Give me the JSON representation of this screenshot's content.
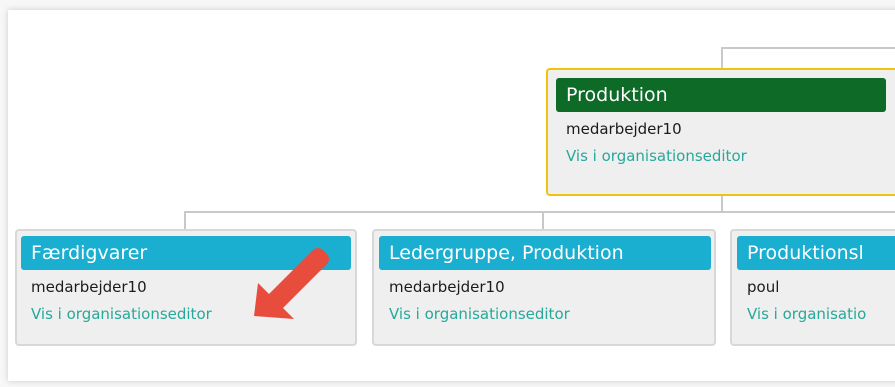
{
  "org_chart": {
    "parent": {
      "title": "Produktion",
      "person": "medarbejder10",
      "link": "Vis i organisationseditor",
      "header_color": "#0d6a27",
      "selected_border_color": "#f0c40c"
    },
    "children": [
      {
        "title": "Færdigvarer",
        "person": "medarbejder10",
        "link": "Vis i organisationseditor",
        "header_color": "#1aaed0"
      },
      {
        "title": "Ledergruppe, Produktion",
        "person": "medarbejder10",
        "link": "Vis i organisationseditor",
        "header_color": "#1aaed0"
      },
      {
        "title": "Produktionsl",
        "person": "poul",
        "link": "Vis i organisatio",
        "header_color": "#1aaed0"
      }
    ],
    "link_color": "#27a89a"
  },
  "annotation": {
    "arrow_color": "#e84c3d",
    "arrow_icon": "red-arrow-icon"
  }
}
